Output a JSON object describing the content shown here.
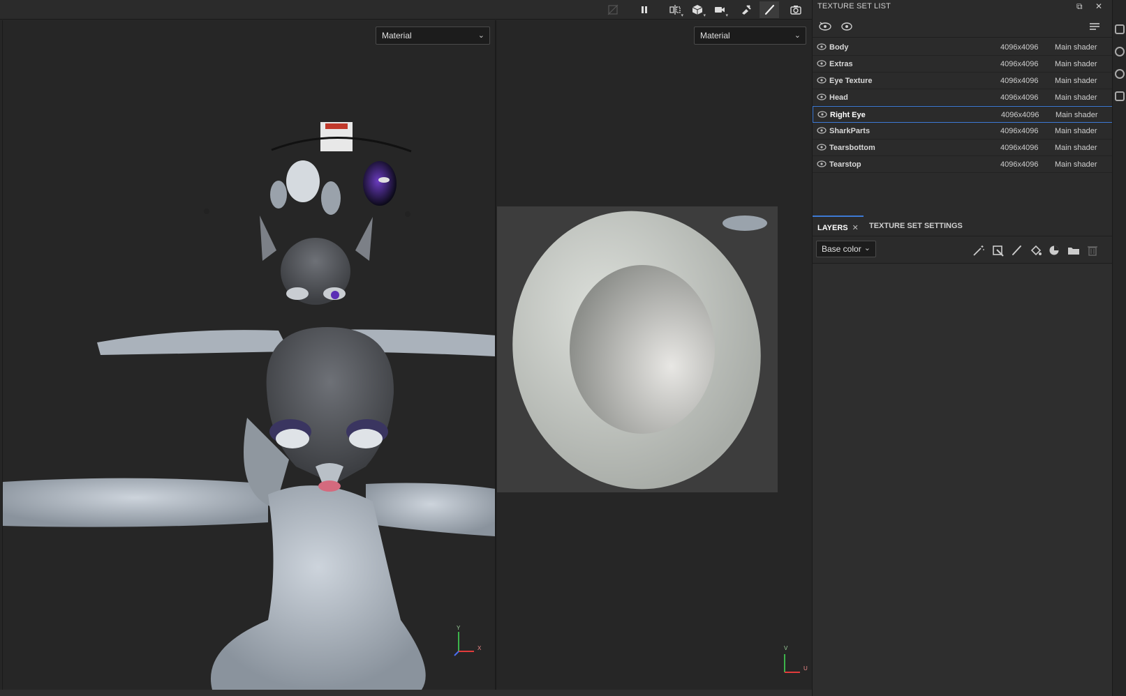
{
  "toolbar": {
    "icons": [
      "hide-overlay-icon",
      "pause-icon",
      "mirror-icon",
      "cube-icon",
      "camera-icon",
      "bake-icon",
      "paint-brush-icon",
      "screenshot-icon"
    ]
  },
  "viewport_3d": {
    "material_dropdown": "Material",
    "axis": {
      "y": "Y",
      "x": "X"
    }
  },
  "viewport_2d": {
    "material_dropdown": "Material",
    "axis": {
      "v": "V",
      "u": "U"
    }
  },
  "texture_set_list": {
    "title": "TEXTURE SET LIST",
    "rows": [
      {
        "name": "Body",
        "resolution": "4096x4096",
        "shader": "Main shader",
        "selected": false
      },
      {
        "name": "Extras",
        "resolution": "4096x4096",
        "shader": "Main shader",
        "selected": false
      },
      {
        "name": "Eye Texture",
        "resolution": "4096x4096",
        "shader": "Main shader",
        "selected": false
      },
      {
        "name": "Head",
        "resolution": "4096x4096",
        "shader": "Main shader",
        "selected": false
      },
      {
        "name": "Right Eye",
        "resolution": "4096x4096",
        "shader": "Main shader",
        "selected": true
      },
      {
        "name": "SharkParts",
        "resolution": "4096x4096",
        "shader": "Main shader",
        "selected": false
      },
      {
        "name": "Tearsbottom",
        "resolution": "4096x4096",
        "shader": "Main shader",
        "selected": false
      },
      {
        "name": "Tearstop",
        "resolution": "4096x4096",
        "shader": "Main shader",
        "selected": false
      }
    ]
  },
  "layers": {
    "tab_layers": "LAYERS",
    "tab_texture_set_settings": "TEXTURE SET SETTINGS",
    "channel_dropdown": "Base color"
  },
  "colors": {
    "accent": "#3d7ad6",
    "panel_bg": "#2b2b2b",
    "viewport_bg": "#262626",
    "uv_bg": "#3d3d3d"
  }
}
